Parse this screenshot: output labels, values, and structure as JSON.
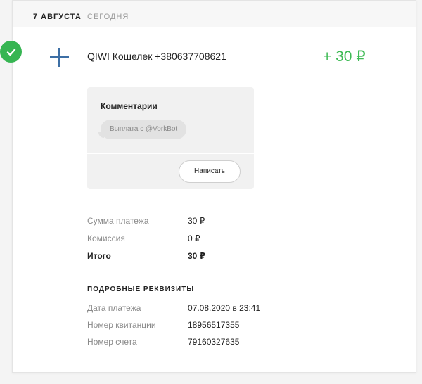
{
  "header": {
    "date": "7 АВГУСТА",
    "relative": "СЕГОДНЯ"
  },
  "transaction": {
    "status_icon": "check-icon",
    "type_icon": "plus-icon",
    "title": "QIWI Кошелек +380637708621",
    "amount": "+ 30 ₽"
  },
  "comments": {
    "title": "Комментарии",
    "items": [
      "Выплата с @VorkBot"
    ],
    "write_button": "Написать"
  },
  "summary": [
    {
      "label": "Сумма платежа",
      "value": "30 ₽"
    },
    {
      "label": "Комиссия",
      "value": "0 ₽"
    },
    {
      "label": "Итого",
      "value": "30 ₽"
    }
  ],
  "details": {
    "heading": "ПОДРОБНЫЕ РЕКВИЗИТЫ",
    "rows": [
      {
        "label": "Дата платежа",
        "value": "07.08.2020 в 23:41"
      },
      {
        "label": "Номер квитанции",
        "value": "18956517355"
      },
      {
        "label": "Номер счета",
        "value": "79160327635"
      }
    ]
  },
  "colors": {
    "accent_green": "#3fba55",
    "status_green": "#36b552",
    "icon_blue": "#3d6fa5"
  }
}
